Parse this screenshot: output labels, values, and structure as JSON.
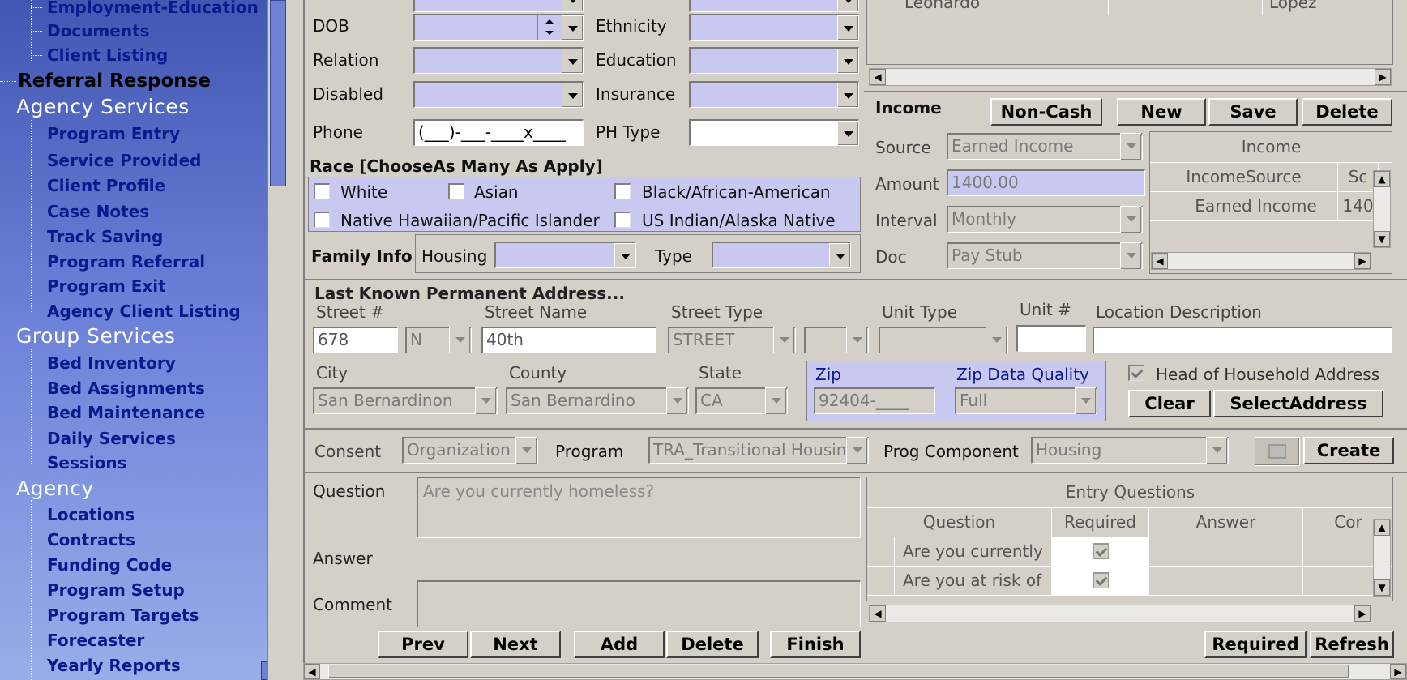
{
  "nav": {
    "items": [
      {
        "label": "Employment-Education",
        "level": "sub"
      },
      {
        "label": "Documents",
        "level": "sub"
      },
      {
        "label": "Client Listing",
        "level": "sub"
      },
      {
        "label": "Referral Response",
        "level": "dark"
      },
      {
        "label": "Agency Services",
        "level": "head"
      },
      {
        "label": "Program Entry",
        "level": "sub"
      },
      {
        "label": "Service Provided",
        "level": "sub"
      },
      {
        "label": "Client Profile",
        "level": "sub"
      },
      {
        "label": "Case Notes",
        "level": "sub"
      },
      {
        "label": "Track Saving",
        "level": "sub"
      },
      {
        "label": "Program Referral",
        "level": "sub"
      },
      {
        "label": "Program Exit",
        "level": "sub"
      },
      {
        "label": "Agency Client Listing",
        "level": "sub"
      },
      {
        "label": "Group Services",
        "level": "head"
      },
      {
        "label": "Bed Inventory",
        "level": "sub"
      },
      {
        "label": "Bed Assignments",
        "level": "sub"
      },
      {
        "label": "Bed Maintenance",
        "level": "sub"
      },
      {
        "label": "Daily Services",
        "level": "sub"
      },
      {
        "label": "Sessions",
        "level": "sub"
      },
      {
        "label": "Agency",
        "level": "head"
      },
      {
        "label": "Locations",
        "level": "sub"
      },
      {
        "label": "Contracts",
        "level": "sub"
      },
      {
        "label": "Funding Code",
        "level": "sub"
      },
      {
        "label": "Program Setup",
        "level": "sub"
      },
      {
        "label": "Program Targets",
        "level": "sub"
      },
      {
        "label": "Forecaster",
        "level": "sub"
      },
      {
        "label": "Yearly Reports",
        "level": "sub"
      }
    ]
  },
  "person": {
    "dob_label": "DOB",
    "relation_label": "Relation",
    "disabled_label": "Disabled",
    "phone_label": "Phone",
    "phone_value": "(___)-___-____x____",
    "ethnicity_label": "Ethnicity",
    "education_label": "Education",
    "insurance_label": "Insurance",
    "ph_type_label": "PH Type"
  },
  "race": {
    "title": "Race [ChooseAs Many As Apply]",
    "white": "White",
    "asian": "Asian",
    "black": "Black/African-American",
    "hawaiian": "Native Hawaiian/Pacific Islander",
    "indian": "US Indian/Alaska Native"
  },
  "family": {
    "title": "Family Info",
    "housing_label": "Housing",
    "type_label": "Type"
  },
  "top_grid": {
    "row_text_1": "Leonardo",
    "row_text_2": "Lopez"
  },
  "income": {
    "title": "Income",
    "buttons": {
      "noncash": "Non-Cash",
      "new": "New",
      "save": "Save",
      "delete": "Delete"
    },
    "source_label": "Source",
    "source_value": "Earned Income",
    "amount_label": "Amount",
    "amount_value": "1400.00",
    "interval_label": "Interval",
    "interval_value": "Monthly",
    "doc_label": "Doc",
    "doc_value": "Pay Stub",
    "grid_title": "Income",
    "col_source": "IncomeSource",
    "col_sc": "Sc",
    "row_source": "Earned Income",
    "row_amount": "140"
  },
  "address": {
    "title": "Last Known Permanent Address...",
    "street_no_label": "Street #",
    "street_no": "678",
    "direction": "N",
    "street_name_label": "Street Name",
    "street_name": "40th",
    "street_type_label": "Street Type",
    "street_type": "STREET",
    "unit_type_label": "Unit Type",
    "unit_no_label": "Unit #",
    "location_desc_label": "Location Description",
    "city_label": "City",
    "city": "San Bernardinon",
    "county_label": "County",
    "county": "San Bernardino",
    "state_label": "State",
    "state": "CA",
    "zip_label": "Zip",
    "zip": "92404-____",
    "zip_quality_label": "Zip Data Quality",
    "zip_quality": "Full",
    "head_of_household": "Head of Household Address",
    "clear_btn": "Clear",
    "select_btn": "SelectAddress"
  },
  "consent": {
    "consent_label": "Consent",
    "consent_value": "Organization",
    "program_label": "Program",
    "program_value": "TRA_Transitional Housing",
    "component_label": "Prog Component",
    "component_value": "Housing",
    "create_btn": "Create"
  },
  "questions": {
    "question_label": "Question",
    "question_value": "Are you currently homeless?",
    "answer_label": "Answer",
    "comment_label": "Comment",
    "grid_title": "Entry Questions",
    "col_question": "Question",
    "col_required": "Required",
    "col_answer": "Answer",
    "col_co": "Cor",
    "rows": [
      {
        "question": "Are you currently"
      },
      {
        "question": "Are you at risk of"
      }
    ],
    "buttons": {
      "prev": "Prev",
      "next": "Next",
      "add": "Add",
      "delete": "Delete",
      "finish": "Finish",
      "required": "Required",
      "refresh": "Refresh"
    }
  }
}
